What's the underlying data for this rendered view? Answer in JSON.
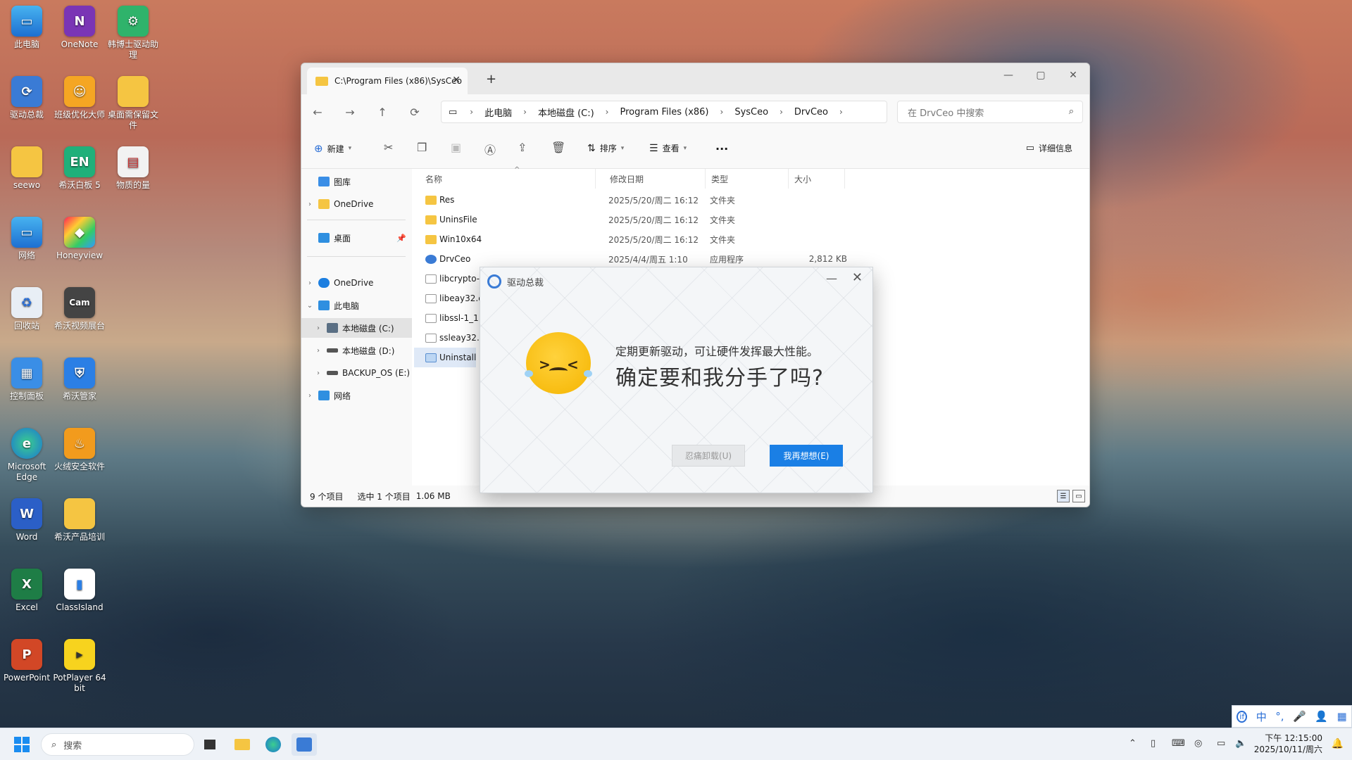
{
  "desktop": {
    "icons": [
      {
        "label": "此电脑"
      },
      {
        "label": "OneNote"
      },
      {
        "label": "韩博士驱动助理"
      },
      {
        "label": "驱动总裁"
      },
      {
        "label": "班级优化大师"
      },
      {
        "label": "桌面需保留文件"
      },
      {
        "label": "seewo"
      },
      {
        "label": "希沃白板 5"
      },
      {
        "label": "物质的量"
      },
      {
        "label": "网络"
      },
      {
        "label": "Honeyview"
      },
      {
        "label": "回收站"
      },
      {
        "label": "希沃视频展台"
      },
      {
        "label": "控制面板"
      },
      {
        "label": "希沃管家"
      },
      {
        "label": "Microsoft Edge"
      },
      {
        "label": "火绒安全软件"
      },
      {
        "label": "Word"
      },
      {
        "label": "希沃产品培训"
      },
      {
        "label": "Excel"
      },
      {
        "label": "ClassIsland"
      },
      {
        "label": "PowerPoint"
      },
      {
        "label": "PotPlayer 64 bit"
      }
    ]
  },
  "explorer": {
    "tab_title": "C:\\Program Files (x86)\\SysCeo",
    "breadcrumbs": [
      "此电脑",
      "本地磁盘 (C:)",
      "Program Files (x86)",
      "SysCeo",
      "DrvCeo"
    ],
    "search_placeholder": "在 DrvCeo 中搜索",
    "toolbar": {
      "new_label": "新建",
      "sort_label": "排序",
      "view_label": "查看",
      "more_label": "···",
      "details_label": "详细信息"
    },
    "nav_pane": {
      "gallery": "图库",
      "onedrive_1": "OneDrive",
      "desktop": "桌面",
      "onedrive_2": "OneDrive",
      "this_pc": "此电脑",
      "drive_c": "本地磁盘 (C:)",
      "drive_d": "本地磁盘 (D:)",
      "drive_e": "BACKUP_OS (E:)",
      "network": "网络"
    },
    "columns": {
      "name": "名称",
      "date": "修改日期",
      "type": "类型",
      "size": "大小"
    },
    "files": [
      {
        "name": "Res",
        "date": "2025/5/20/周二 16:12",
        "type": "文件夹",
        "size": "",
        "kind": "folder"
      },
      {
        "name": "UninsFile",
        "date": "2025/5/20/周二 16:12",
        "type": "文件夹",
        "size": "",
        "kind": "folder"
      },
      {
        "name": "Win10x64",
        "date": "2025/5/20/周二 16:12",
        "type": "文件夹",
        "size": "",
        "kind": "folder"
      },
      {
        "name": "DrvCeo",
        "date": "2025/4/4/周五 1:10",
        "type": "应用程序",
        "size": "2,812 KB",
        "kind": "app"
      },
      {
        "name": "libcrypto-",
        "date": "",
        "type": "",
        "size": "",
        "kind": "file"
      },
      {
        "name": "libeay32.d",
        "date": "",
        "type": "",
        "size": "",
        "kind": "file"
      },
      {
        "name": "libssl-1_1.",
        "date": "",
        "type": "",
        "size": "",
        "kind": "file"
      },
      {
        "name": "ssleay32.d",
        "date": "",
        "type": "",
        "size": "",
        "kind": "file"
      },
      {
        "name": "Uninstall",
        "date": "",
        "type": "",
        "size": "",
        "kind": "uninstall"
      }
    ],
    "status": {
      "count": "9 个项目",
      "selection": "选中 1 个项目",
      "size": "1.06 MB"
    }
  },
  "dialog": {
    "title": "驱动总裁",
    "subtitle": "定期更新驱动，可让硬件发挥最大性能。",
    "message": "确定要和我分手了吗?",
    "btn_uninstall": "忍痛卸载(U)",
    "btn_keep": "我再想想(E)"
  },
  "taskbar": {
    "search_placeholder": "搜索",
    "time": "下午 12:15:00",
    "date": "2025/10/11/周六"
  },
  "ime": {
    "mode": "中"
  },
  "colors": {
    "accent": "#1a7fe5",
    "folder": "#f5c542"
  }
}
